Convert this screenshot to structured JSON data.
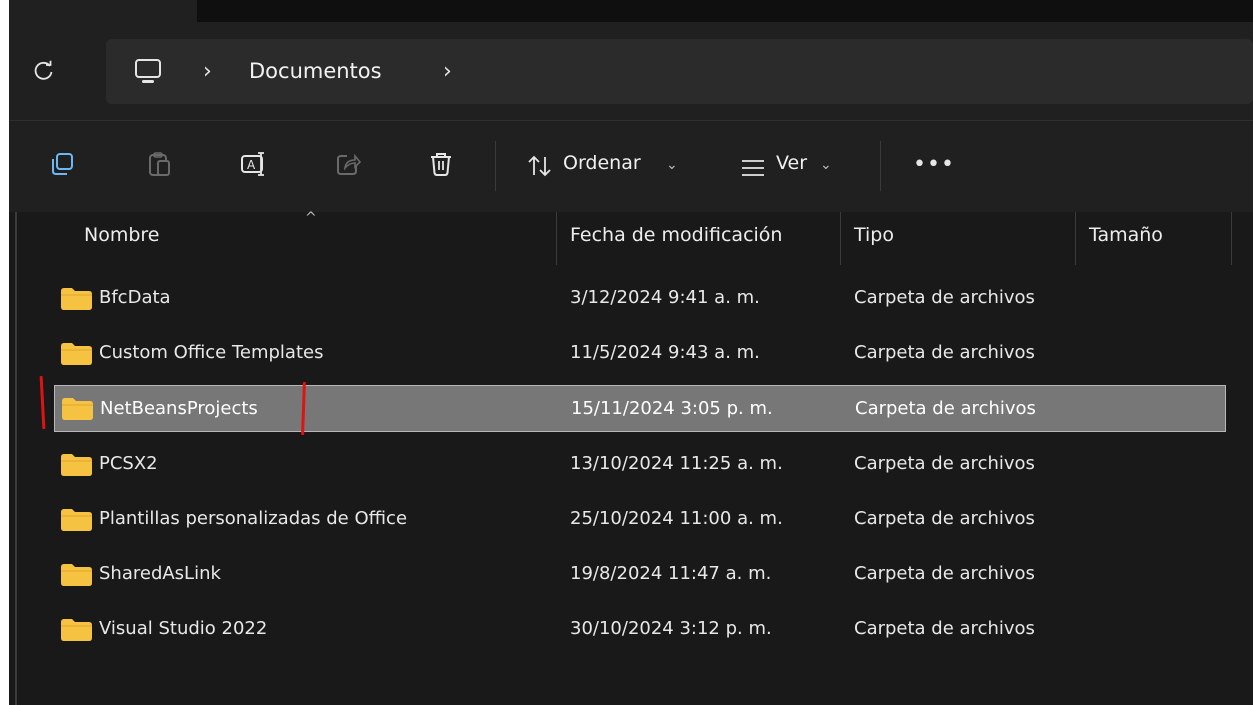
{
  "address": {
    "refresh_icon": "refresh-icon",
    "location_icon": "this-pc-icon",
    "crumb": "Documentos"
  },
  "toolbar": {
    "copy_icon": "copy-icon",
    "paste_icon": "paste-icon",
    "rename_icon": "rename-icon",
    "share_icon": "share-icon",
    "delete_icon": "trash-icon",
    "sort_label": "Ordenar",
    "view_label": "Ver",
    "more_label": "•••"
  },
  "columns": {
    "name": "Nombre",
    "date": "Fecha de modificación",
    "type": "Tipo",
    "size": "Tamaño"
  },
  "files": [
    {
      "name": "BfcData",
      "date": "3/12/2024 9:41 a. m.",
      "type": "Carpeta de archivos",
      "selected": false
    },
    {
      "name": "Custom Office Templates",
      "date": "11/5/2024 9:43 a. m.",
      "type": "Carpeta de archivos",
      "selected": false
    },
    {
      "name": "NetBeansProjects",
      "date": "15/11/2024 3:05 p. m.",
      "type": "Carpeta de archivos",
      "selected": true
    },
    {
      "name": "PCSX2",
      "date": "13/10/2024 11:25 a. m.",
      "type": "Carpeta de archivos",
      "selected": false
    },
    {
      "name": "Plantillas personalizadas de Office",
      "date": "25/10/2024 11:00 a. m.",
      "type": "Carpeta de archivos",
      "selected": false
    },
    {
      "name": "SharedAsLink",
      "date": "19/8/2024 11:47 a. m.",
      "type": "Carpeta de archivos",
      "selected": false
    },
    {
      "name": "Visual Studio 2022",
      "date": "30/10/2024 3:12 p. m.",
      "type": "Carpeta de archivos",
      "selected": false
    }
  ],
  "colors": {
    "folder": "#f5c242",
    "selection": "#777777",
    "annotation_red": "#e01313"
  }
}
